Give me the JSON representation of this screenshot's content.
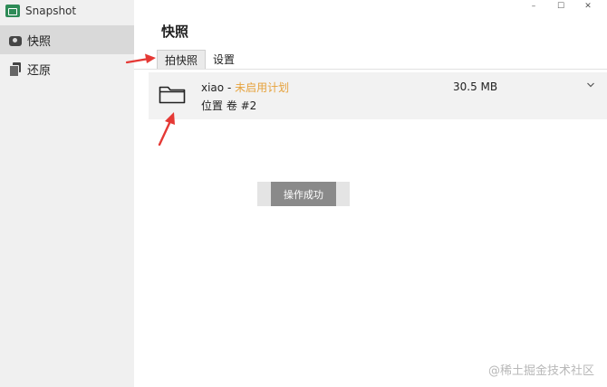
{
  "app": {
    "title": "Snapshot"
  },
  "window_controls": {
    "minimize": "–",
    "maximize": "☐",
    "close": "✕"
  },
  "sidebar": {
    "items": [
      {
        "label": "快照",
        "icon": "camera-icon",
        "active": true
      },
      {
        "label": "还原",
        "icon": "restore-icon",
        "active": false
      }
    ]
  },
  "main": {
    "title": "快照",
    "tabs": [
      {
        "label": "拍快照",
        "active": true
      },
      {
        "label": "设置",
        "active": false
      }
    ],
    "volume": {
      "name": "xiao",
      "separator": " - ",
      "status": "未启用计划",
      "location": "位置 卷 #2",
      "size": "30.5 MB"
    },
    "toast": "操作成功"
  },
  "watermark": "@稀土掘金技术社区",
  "colors": {
    "status": "#e6a23c",
    "annotation_arrow": "#e53935",
    "sidebar_active": "#d9d9d9"
  }
}
